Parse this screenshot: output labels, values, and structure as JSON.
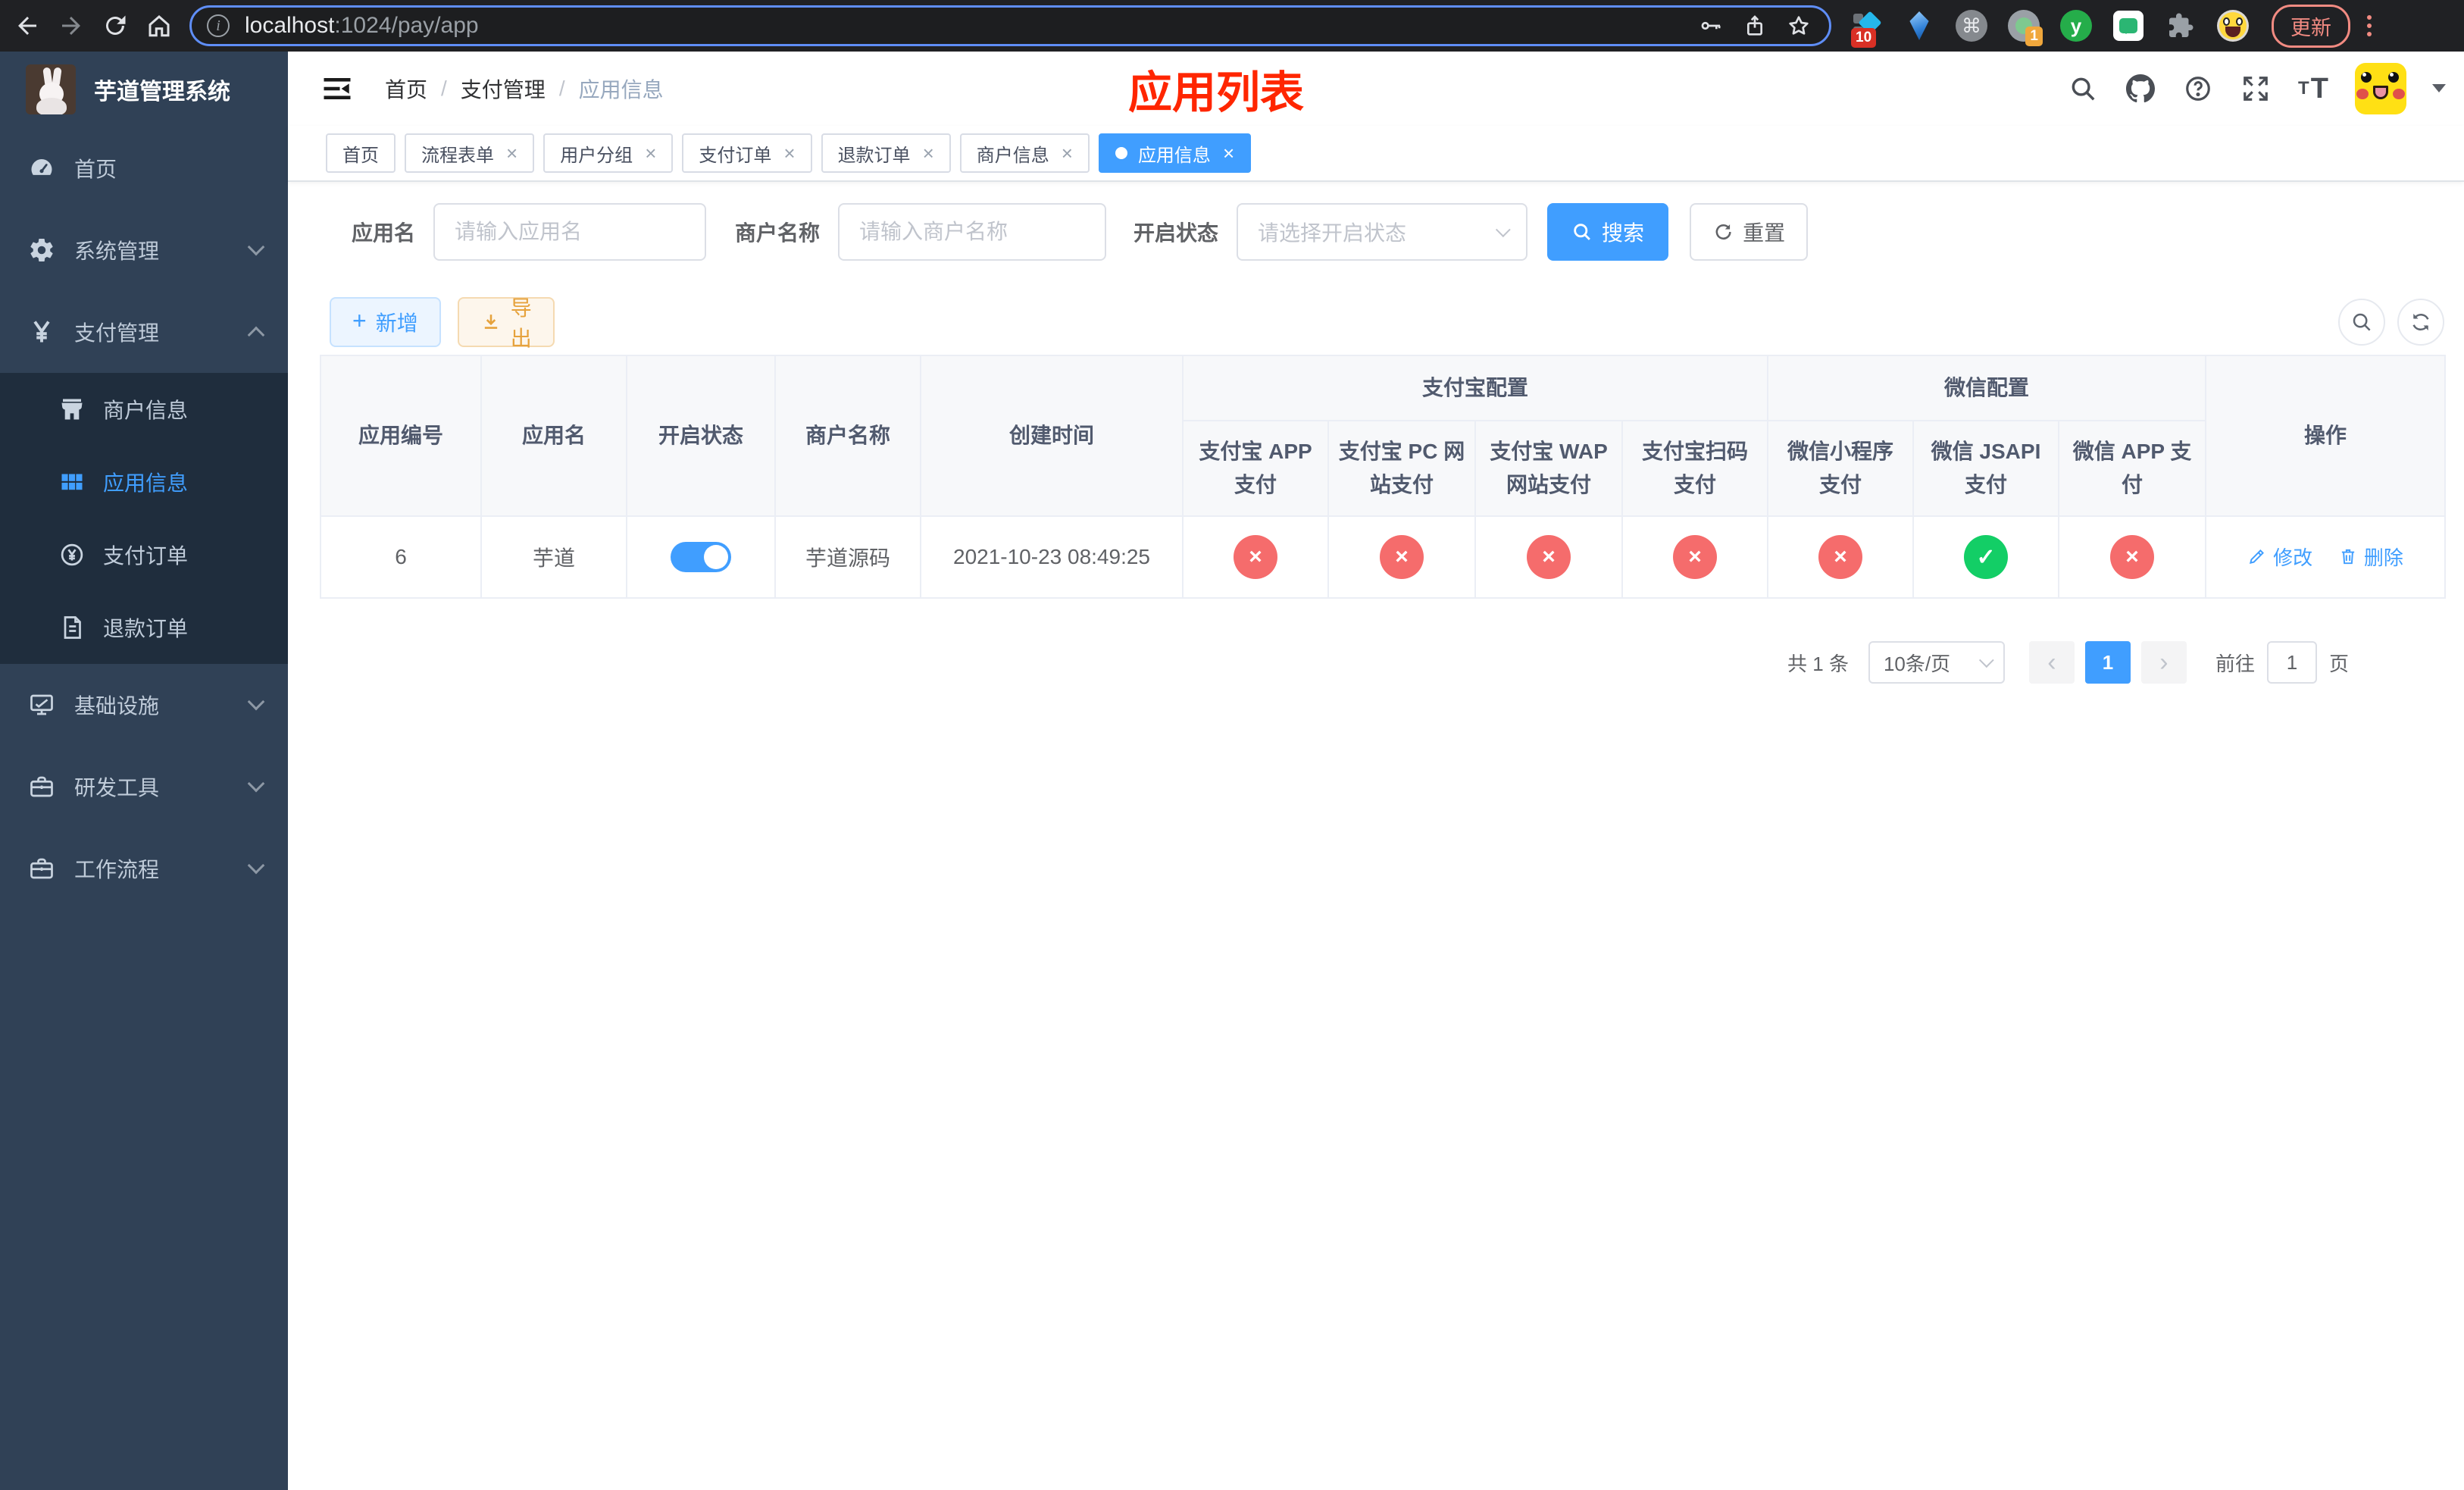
{
  "colors": {
    "accent": "#409eff",
    "danger": "#f56c6c",
    "success": "#13ce66",
    "warning": "#e6a23c",
    "annotation_red": "#ff2600",
    "sidebar_bg": "#304156",
    "submenu_bg": "#1f2d3d"
  },
  "browser": {
    "url_host": "localhost",
    "url_rest": ":1024/pay/app",
    "ext_badge_a": "10",
    "ext_badge_b": "1",
    "ext_cmd": "⌘",
    "ext_letter": "y",
    "update_label": "更新"
  },
  "sidebar": {
    "logo_title": "芋道管理系统",
    "items": [
      {
        "key": "home",
        "label": "首页",
        "icon": "dashboard-icon",
        "level": 1
      },
      {
        "key": "system",
        "label": "系统管理",
        "icon": "gear-icon",
        "level": 1,
        "arrow": "down"
      },
      {
        "key": "payment",
        "label": "支付管理",
        "icon": "yen-icon",
        "level": 1,
        "arrow": "up"
      },
      {
        "key": "merchant-info",
        "label": "商户信息",
        "icon": "shop-icon",
        "level": 2
      },
      {
        "key": "app-info",
        "label": "应用信息",
        "icon": "grid-icon",
        "level": 2,
        "active": true
      },
      {
        "key": "payment-order",
        "label": "支付订单",
        "icon": "yen-circle-icon",
        "level": 2
      },
      {
        "key": "refund-order",
        "label": "退款订单",
        "icon": "document-icon",
        "level": 2
      },
      {
        "key": "infrastructure",
        "label": "基础设施",
        "icon": "monitor-icon",
        "level": 1,
        "arrow": "down"
      },
      {
        "key": "dev-tools",
        "label": "研发工具",
        "icon": "briefcase-icon",
        "level": 1,
        "arrow": "down"
      },
      {
        "key": "workflow",
        "label": "工作流程",
        "icon": "workflow-icon",
        "level": 1,
        "arrow": "down"
      }
    ]
  },
  "header": {
    "breadcrumb": [
      "首页",
      "支付管理",
      "应用信息"
    ],
    "separator": "/",
    "annotation": "应用列表"
  },
  "tabs": [
    {
      "key": "home",
      "label": "首页",
      "closable": false
    },
    {
      "key": "process-form",
      "label": "流程表单",
      "closable": true
    },
    {
      "key": "user-group",
      "label": "用户分组",
      "closable": true
    },
    {
      "key": "payment-order",
      "label": "支付订单",
      "closable": true
    },
    {
      "key": "refund-order",
      "label": "退款订单",
      "closable": true
    },
    {
      "key": "merchant-info",
      "label": "商户信息",
      "closable": true
    },
    {
      "key": "app-info",
      "label": "应用信息",
      "closable": true,
      "active": true
    }
  ],
  "filters": {
    "app_name_label": "应用名",
    "app_name_placeholder": "请输入应用名",
    "merchant_label": "商户名称",
    "merchant_placeholder": "请输入商户名称",
    "status_label": "开启状态",
    "status_placeholder": "请选择开启状态",
    "search_label": "搜索",
    "reset_label": "重置"
  },
  "toolbar": {
    "add_label": "新增",
    "export_label": "导出"
  },
  "table": {
    "main_headers": [
      "应用编号",
      "应用名",
      "开启状态",
      "商户名称",
      "创建时间"
    ],
    "group_headers": [
      {
        "label": "支付宝配置"
      },
      {
        "label": "微信配置"
      }
    ],
    "sub_headers": [
      "支付宝 APP 支付",
      "支付宝 PC 网站支付",
      "支付宝 WAP 网站支付",
      "支付宝扫码支付",
      "微信小程序支付",
      "微信 JSAPI 支付",
      "微信 APP 支付"
    ],
    "action_header": "操作",
    "row": {
      "id": "6",
      "app_name": "芋道",
      "enabled": true,
      "merchant_name": "芋道源码",
      "create_time": "2021-10-23 08:49:25",
      "channel_status": [
        "fail",
        "fail",
        "fail",
        "fail",
        "fail",
        "success",
        "fail"
      ],
      "edit_label": "修改",
      "delete_label": "删除"
    }
  },
  "pagination": {
    "total_label": "共 1 条",
    "page_size": "10条/页",
    "prev_label": "‹",
    "current_page": "1",
    "next_label": "›",
    "goto_label": "前往",
    "goto_value": "1",
    "page_label": "页"
  }
}
